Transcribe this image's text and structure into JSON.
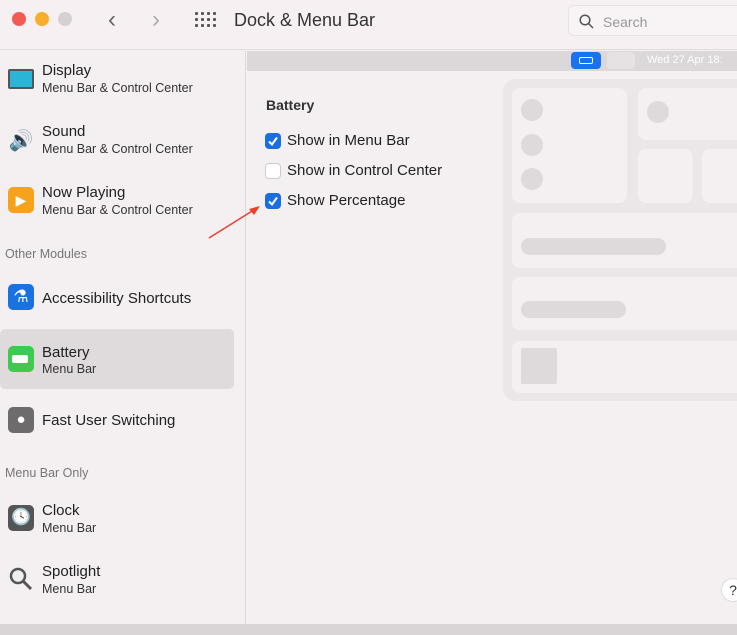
{
  "window": {
    "title": "Dock & Menu Bar",
    "search_placeholder": "Search"
  },
  "menubar_preview": {
    "date": "Wed 27 Apr 18:"
  },
  "sidebar": {
    "items": [
      {
        "label": "Display",
        "sub": "Menu Bar & Control Center"
      },
      {
        "label": "Sound",
        "sub": "Menu Bar & Control Center"
      },
      {
        "label": "Now Playing",
        "sub": "Menu Bar & Control Center"
      },
      {
        "label": "Accessibility Shortcuts"
      },
      {
        "label": "Battery",
        "sub": "Menu Bar",
        "selected": true
      },
      {
        "label": "Fast User Switching"
      },
      {
        "label": "Clock",
        "sub": "Menu Bar"
      },
      {
        "label": "Spotlight",
        "sub": "Menu Bar"
      }
    ],
    "headers": [
      "Other Modules",
      "Menu Bar Only"
    ]
  },
  "main": {
    "section": "Battery",
    "options": [
      {
        "label": "Show in Menu Bar",
        "checked": true
      },
      {
        "label": "Show in Control Center",
        "checked": false
      },
      {
        "label": "Show Percentage",
        "checked": true
      }
    ],
    "help": "?"
  },
  "colors": {
    "accent": "#1a6fe0",
    "arrow": "#e8412c"
  }
}
